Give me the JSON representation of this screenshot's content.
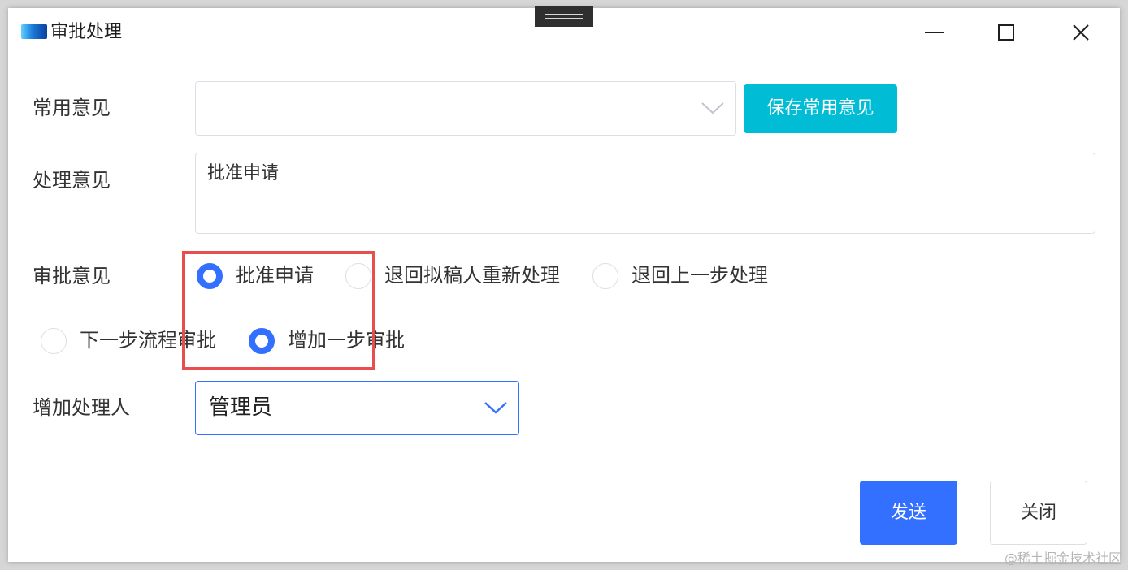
{
  "window": {
    "title": "审批处理"
  },
  "form": {
    "common_opinion": {
      "label": "常用意见",
      "value": "",
      "save_button": "保存常用意见"
    },
    "process_opinion": {
      "label": "处理意见",
      "value": "批准申请"
    },
    "approval_opinion": {
      "label": "审批意见",
      "options": [
        {
          "label": "批准申请",
          "checked": true
        },
        {
          "label": "退回拟稿人重新处理",
          "checked": false
        },
        {
          "label": "退回上一步处理",
          "checked": false
        },
        {
          "label": "下一步流程审批",
          "checked": false
        },
        {
          "label": "增加一步审批",
          "checked": true
        }
      ]
    },
    "add_handler": {
      "label": "增加处理人",
      "value": "管理员"
    }
  },
  "footer": {
    "send_button": "发送",
    "close_button": "关闭"
  },
  "watermark": "@稀土掘金技术社区",
  "colors": {
    "primary": "#3370ff",
    "save_button": "#00bcd4",
    "highlight": "#e94e4e"
  }
}
